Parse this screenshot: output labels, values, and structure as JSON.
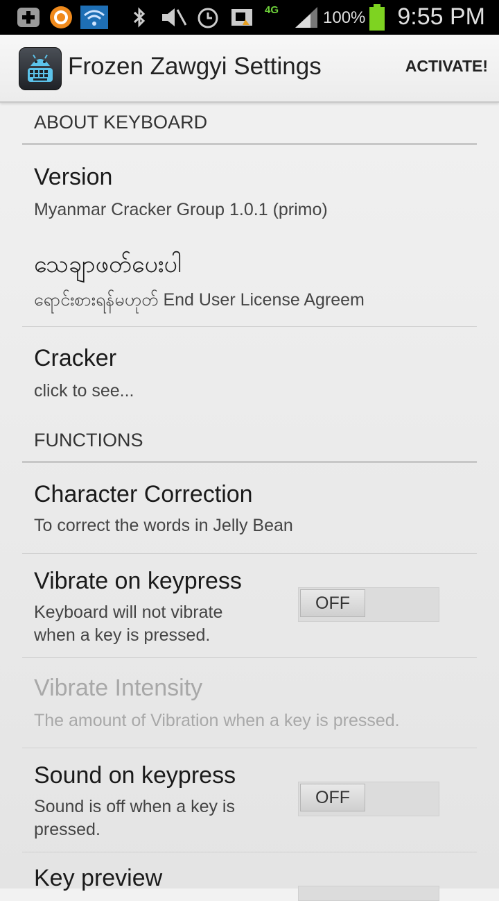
{
  "status_bar": {
    "battery_percent": "100%",
    "time": "9:55 PM",
    "network": "4G",
    "icons": [
      "add-icon",
      "avast-icon",
      "wifi-icon",
      "bluetooth-icon",
      "mute-icon",
      "alarm-icon",
      "screenshot-icon",
      "signal-icon",
      "battery-icon"
    ]
  },
  "action_bar": {
    "title": "Frozen Zawgyi Settings",
    "activate_label": "ACTIVATE!",
    "icon": "keyboard-app-icon"
  },
  "categories": {
    "about": "ABOUT KEYBOARD",
    "functions": "FUNCTIONS"
  },
  "prefs": {
    "version": {
      "title": "Version",
      "summary": "Myanmar Cracker Group 1.0.1 (primo)"
    },
    "eula": {
      "title": "သေချာဖတ်ပေးပါ",
      "summary": "ရောင်းစားရန်မဟုတ်           End User License Agreem"
    },
    "cracker": {
      "title": "Cracker",
      "summary": "click to see..."
    },
    "char_correction": {
      "title": "Character Correction",
      "summary": "To correct the words in Jelly Bean"
    },
    "vibrate": {
      "title": "Vibrate on keypress",
      "summary1": "Keyboard will not vibrate",
      "summary2": "when a key is pressed.",
      "toggle": "OFF"
    },
    "vibrate_intensity": {
      "title": "Vibrate Intensity",
      "summary": "The amount of Vibration when a key is pressed."
    },
    "sound": {
      "title": "Sound on keypress",
      "summary1": "Sound is off when a key is",
      "summary2": "pressed.",
      "toggle": "OFF"
    },
    "key_preview": {
      "title": "Key preview"
    }
  },
  "colors": {
    "accent_battery": "#7ed321",
    "background": "#efefef"
  }
}
